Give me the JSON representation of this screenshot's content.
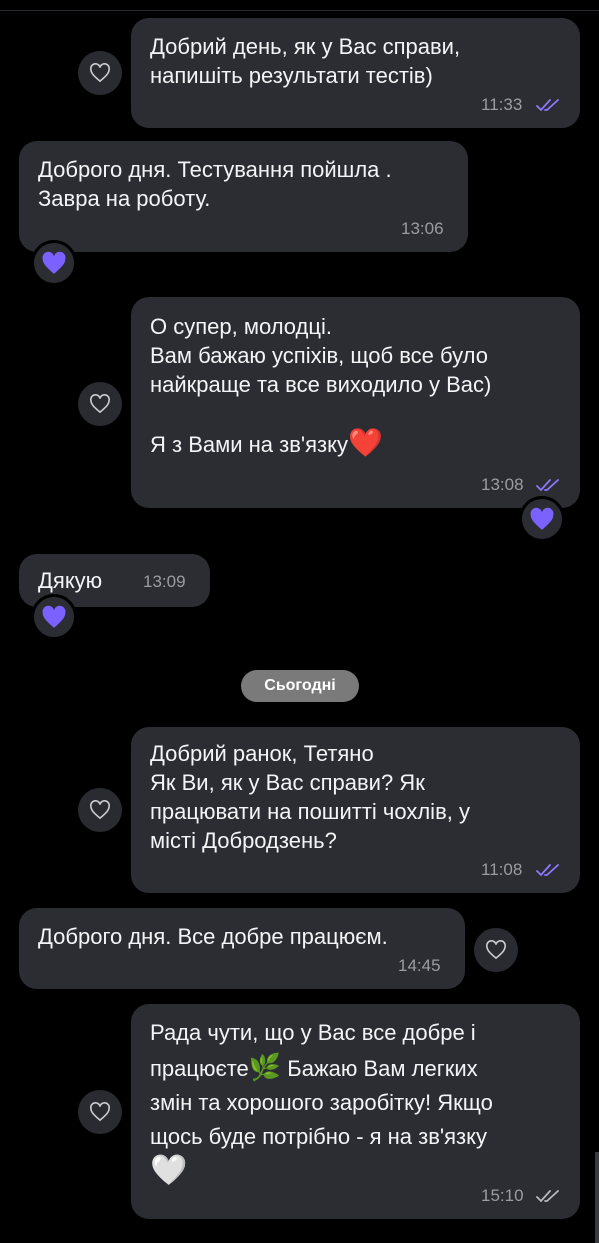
{
  "date_separator": "Сьогодні",
  "colors": {
    "bubble": "#2c2d33",
    "accent_heart": "#7b61ff",
    "check": "#8a79ff"
  },
  "messages": [
    {
      "id": "m1",
      "direction": "outgoing",
      "text": "Добрий день, як у Вас справи,\nнапишіть результати тестів)",
      "time": "11:33",
      "read": true
    },
    {
      "id": "m2",
      "direction": "incoming",
      "text": "Доброго дня.  Тестування пойшла .\nЗавра на роботу.",
      "time": "13:06",
      "reaction": "purple-heart"
    },
    {
      "id": "m3",
      "direction": "outgoing",
      "text": "О супер, молодці.\nВам бажаю успіхів, щоб все було\nнайкраще та все виходило у Вас)\n\nЯ з Вами на зв'язку",
      "time": "13:08",
      "read": true,
      "reaction": "purple-heart",
      "emoji": "❤️"
    },
    {
      "id": "m4",
      "direction": "incoming",
      "text": "Дякую",
      "time": "13:09",
      "reaction": "purple-heart"
    },
    {
      "id": "m5",
      "direction": "outgoing",
      "text": "Добрий ранок, Тетяно\nЯк Ви, як у Вас справи? Як\nпрацювати на пошитті чохлів, у\nмісті Добродзень?",
      "time": "11:08",
      "read": true
    },
    {
      "id": "m6",
      "direction": "incoming",
      "text": "Доброго дня.  Все добре працюєм.",
      "time": "14:45"
    },
    {
      "id": "m7",
      "direction": "outgoing",
      "text_line1": "Рада чути, що у Вас все добре і",
      "text_line2a": "працюєте",
      "emoji_leaf": "🌿",
      "text_line2b": " Бажаю Вам легких",
      "text_rest": "змін та хорошого заробітку! Якщо\nщось буде потрібно - я на зв'язку",
      "emoji_heart": "🤍",
      "time": "15:10",
      "read": true
    }
  ]
}
